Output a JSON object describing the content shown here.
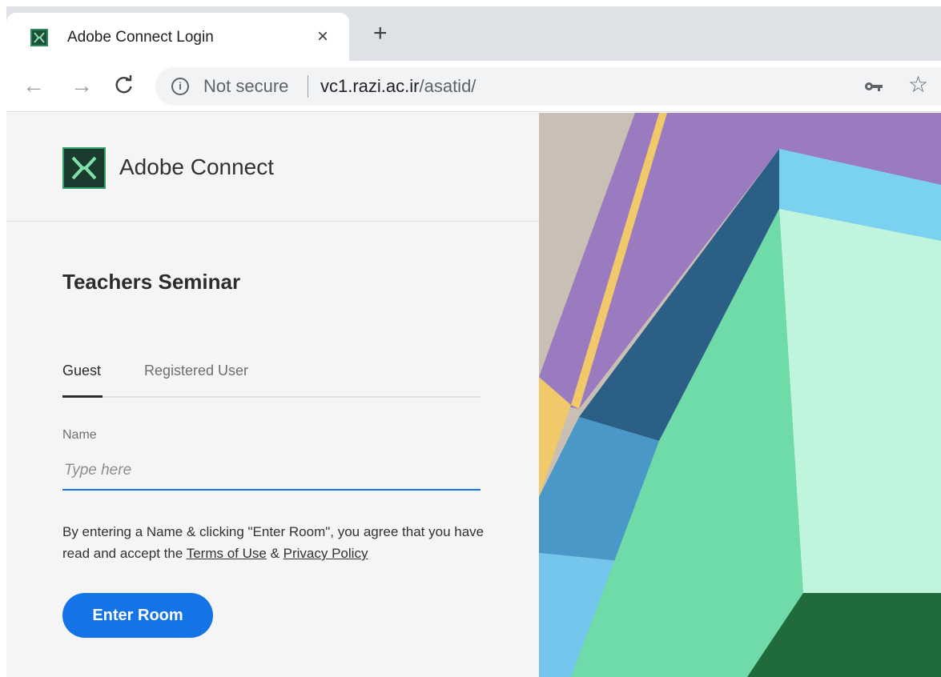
{
  "browser": {
    "tab_title": "Adobe Connect Login",
    "tab_close_glyph": "×",
    "new_tab_glyph": "+",
    "back_glyph": "←",
    "forward_glyph": "→",
    "reload_glyph": "C",
    "info_glyph": "i",
    "security_text": "Not secure",
    "url_host": "vc1.razi.ac.ir",
    "url_path": "/asatid/",
    "star_glyph": "☆",
    "icons": [
      "favicon-icon",
      "info-icon",
      "key-icon",
      "star-icon"
    ]
  },
  "brand": {
    "name": "Adobe Connect"
  },
  "meeting": {
    "title": "Teachers Seminar"
  },
  "login_tabs": {
    "guest": "Guest",
    "registered": "Registered User",
    "active": "Guest"
  },
  "form": {
    "name_label": "Name",
    "name_placeholder": "Type here",
    "name_value": ""
  },
  "consent": {
    "text_before": "By entering a Name & clicking \"Enter Room\", you agree that you have read and accept the ",
    "terms_link": "Terms of Use",
    "amp": " & ",
    "privacy_link": "Privacy Policy"
  },
  "actions": {
    "enter_room": "Enter Room"
  },
  "colors": {
    "accent": "#1473e6",
    "panel_bg": "#f5f5f5",
    "brand_green": "#33a06a"
  }
}
